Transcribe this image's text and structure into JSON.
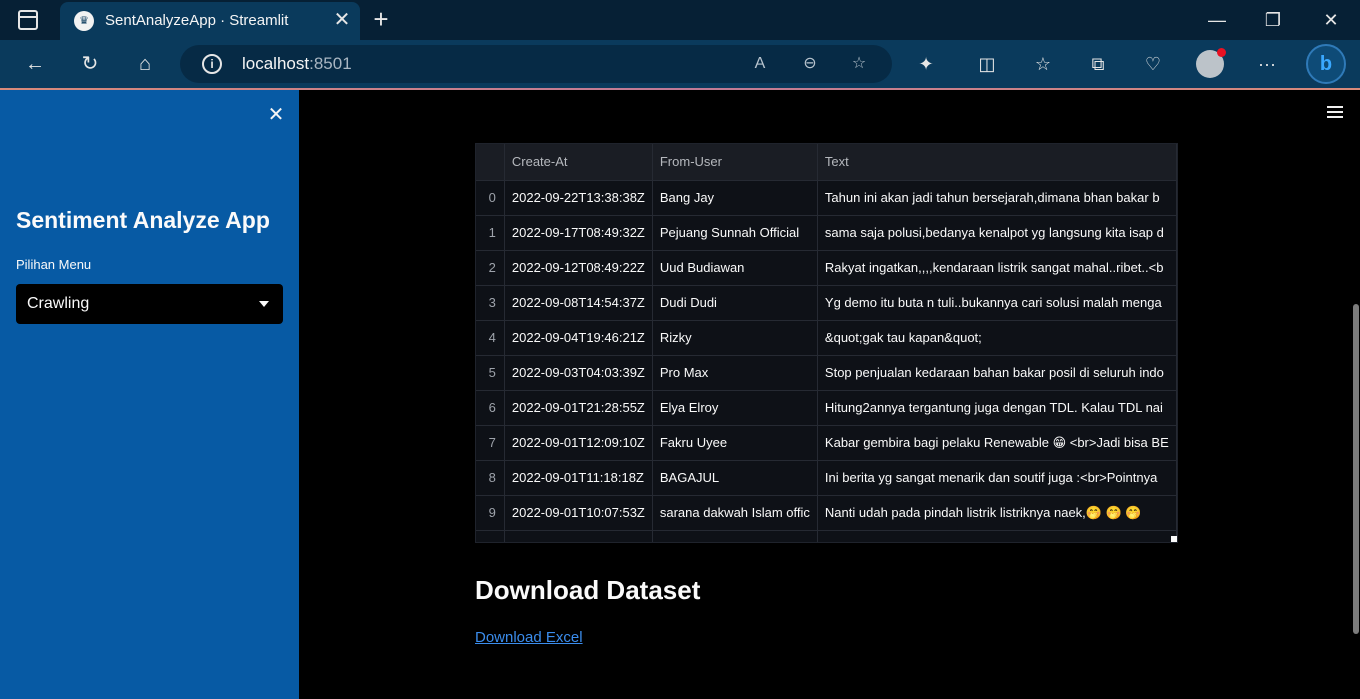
{
  "browser": {
    "tab_title": "SentAnalyzeApp · Streamlit",
    "url_host": "localhost",
    "url_port": ":8501",
    "tab_close": "✕",
    "new_tab": "+"
  },
  "sidebar": {
    "title": "Sentiment Analyze App",
    "menu_label": "Pilihan Menu",
    "menu_value": "Crawling"
  },
  "table": {
    "columns": [
      "",
      "Create-At",
      "From-User",
      "Text"
    ],
    "rows": [
      [
        "0",
        "2022-09-22T13:38:38Z",
        "Bang Jay",
        "Tahun ini akan jadi tahun bersejarah,dimana bhan bakar b"
      ],
      [
        "1",
        "2022-09-17T08:49:32Z",
        "Pejuang Sunnah Official",
        "sama saja polusi,bedanya kenalpot yg langsung kita isap d"
      ],
      [
        "2",
        "2022-09-12T08:49:22Z",
        "Uud Budiawan",
        "Rakyat ingatkan,,,,kendaraan listrik sangat mahal..ribet..<b"
      ],
      [
        "3",
        "2022-09-08T14:54:37Z",
        "Dudi Dudi",
        "Yg demo itu buta n tuli..bukannya cari solusi malah menga"
      ],
      [
        "4",
        "2022-09-04T19:46:21Z",
        "Rizky",
        "&quot;gak tau kapan&quot;"
      ],
      [
        "5",
        "2022-09-03T04:03:39Z",
        "Pro Max",
        "Stop penjualan kedaraan bahan bakar posil di seluruh indo"
      ],
      [
        "6",
        "2022-09-01T21:28:55Z",
        "Elya Elroy",
        "Hitung2annya tergantung juga dengan TDL. Kalau TDL nai"
      ],
      [
        "7",
        "2022-09-01T12:09:10Z",
        "Fakru Uyee",
        "Kabar gembira bagi pelaku Renewable 😁 <br>Jadi bisa BE"
      ],
      [
        "8",
        "2022-09-01T11:18:18Z",
        "BAGAJUL",
        "Ini berita yg sangat menarik dan soutif juga :<br>Pointnya"
      ],
      [
        "9",
        "2022-09-01T10:07:53Z",
        "sarana dakwah Islam offic",
        "Nanti udah pada pindah listrik listriknya naek,🤭 🤭 🤭"
      ]
    ]
  },
  "download": {
    "heading": "Download Dataset",
    "link_label": "Download Excel"
  }
}
